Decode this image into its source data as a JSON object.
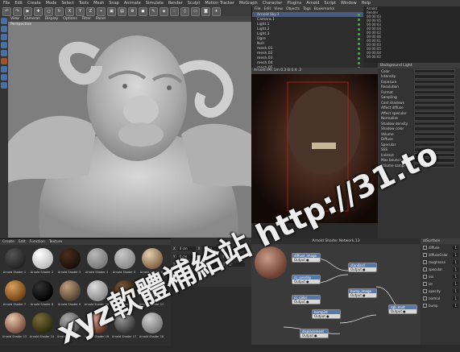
{
  "menubar": [
    "File",
    "Edit",
    "Create",
    "Mode",
    "Select",
    "Tools",
    "Mesh",
    "Snap",
    "Animate",
    "Simulate",
    "Render",
    "Sculpt",
    "Motion Tracker",
    "MoGraph",
    "Character",
    "Plugins",
    "Arnold",
    "Script",
    "Window",
    "Help"
  ],
  "layout_label": "Layout:",
  "viewport": {
    "menu": [
      "View",
      "Cameras",
      "Display",
      "Options",
      "Filter",
      "Panel"
    ],
    "label": "Perspective"
  },
  "object_manager": {
    "menu": [
      "File",
      "Edit",
      "View",
      "Objects",
      "Tags",
      "Bookmarks"
    ],
    "rows": [
      "Arnold Sky.1",
      "Camera.1",
      "Light.1",
      "Light.2",
      "Light.3",
      "Ogre",
      "Null",
      "mesh.01",
      "mesh.02",
      "mesh.03",
      "mesh.04",
      "mesh.05"
    ]
  },
  "right_panel": {
    "rows": [
      "Arnold",
      "Render",
      "00:00:03",
      "00:00:05",
      "00:00:03",
      "00:00:04",
      "00:00:02",
      "00:00:06",
      "00:00:01",
      "00:00:03",
      "00:00:05",
      "00:00:04",
      "00:00:02"
    ]
  },
  "render_view": {
    "title": "Arnold IPR 1m 0.3 B 0.4 .2"
  },
  "attributes": {
    "title": "Background Light",
    "rows": [
      "Color",
      "Intensity",
      "Exposure",
      "Resolution",
      "Format",
      "Sampling",
      "Cast shadows",
      "Affect diffuse",
      "Affect specular",
      "Normalize",
      "Shadow density",
      "Shadow color",
      "Volume",
      "Diffuse",
      "Specular",
      "SSS",
      "Indirect",
      "Max bounces",
      "Volume samples"
    ]
  },
  "material_manager": {
    "menu": [
      "Create",
      "Edit",
      "Function",
      "Texture"
    ],
    "materials": [
      "Arnold Shader 1",
      "Arnold Shader 2",
      "Arnold Shader 3",
      "Arnold Shader 4",
      "Arnold Shader 5",
      "Arnold Shader 6",
      "Arnold Shader 7",
      "Arnold Shader 8",
      "Arnold Shader 9",
      "Arnold Shader 10",
      "Arnold Shader 11",
      "Arnold Shader 12",
      "Arnold Shader 13",
      "Arnold Shader 14",
      "Arnold Shader 15",
      "Arnold Shader 16",
      "Arnold Shader 17",
      "Arnold Shader 18"
    ]
  },
  "coordinates": {
    "labels": [
      "X",
      "Y",
      "Z"
    ],
    "position": [
      "0 cm",
      "0 cm",
      "0 cm"
    ],
    "scale": [
      "0 cm",
      "0 cm",
      "0 cm"
    ],
    "rotation": [
      "0°",
      "0°",
      "0°"
    ],
    "apply_label": "Apply",
    "mode_label": "Object (Rel)"
  },
  "node_editor": {
    "title": "Arnold Shader Network.13",
    "nodes": [
      "diffuse_image",
      "cc_overlay",
      "standard",
      "cc_color",
      "bump_image",
      "bump2d",
      "displacement",
      "rgb_mult"
    ],
    "bottom_label": "Displacement (image)"
  },
  "node_attributes": {
    "title": "alSurface",
    "rows": [
      "diffuse",
      "diffuseColor",
      "roughness",
      "specular",
      "sss",
      "ior",
      "opacity",
      "normal",
      "bump"
    ]
  },
  "watermark": "xyz軟體補給站 http://31.to",
  "colors": {
    "accent": "#4a6fa5",
    "render_bg": "#1a0d08",
    "node_header": "#5577aa"
  }
}
